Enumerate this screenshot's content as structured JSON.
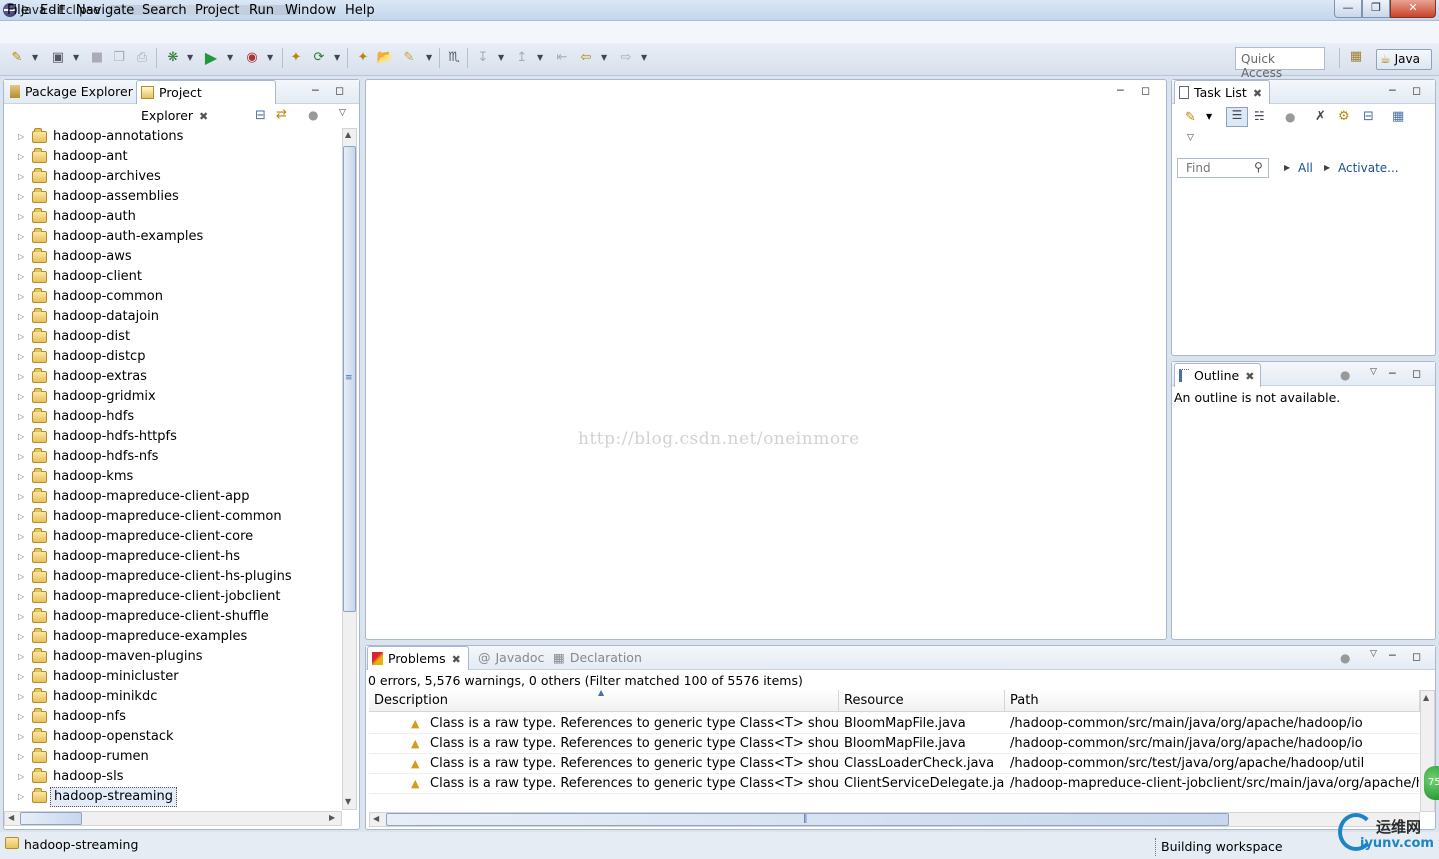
{
  "window": {
    "title": "Java - Eclipse"
  },
  "menu": [
    "File",
    "Edit",
    "Navigate",
    "Search",
    "Project",
    "Run",
    "Window",
    "Help"
  ],
  "toolbar": {
    "quick_access": "Quick Access",
    "perspective": "Java"
  },
  "left_panel": {
    "tabs": [
      "Package Explorer",
      "Project Explorer"
    ],
    "projects": [
      "hadoop-annotations",
      "hadoop-ant",
      "hadoop-archives",
      "hadoop-assemblies",
      "hadoop-auth",
      "hadoop-auth-examples",
      "hadoop-aws",
      "hadoop-client",
      "hadoop-common",
      "hadoop-datajoin",
      "hadoop-dist",
      "hadoop-distcp",
      "hadoop-extras",
      "hadoop-gridmix",
      "hadoop-hdfs",
      "hadoop-hdfs-httpfs",
      "hadoop-hdfs-nfs",
      "hadoop-kms",
      "hadoop-mapreduce-client-app",
      "hadoop-mapreduce-client-common",
      "hadoop-mapreduce-client-core",
      "hadoop-mapreduce-client-hs",
      "hadoop-mapreduce-client-hs-plugins",
      "hadoop-mapreduce-client-jobclient",
      "hadoop-mapreduce-client-shuffle",
      "hadoop-mapreduce-examples",
      "hadoop-maven-plugins",
      "hadoop-minicluster",
      "hadoop-minikdc",
      "hadoop-nfs",
      "hadoop-openstack",
      "hadoop-rumen",
      "hadoop-sls",
      "hadoop-streaming"
    ],
    "selected": "hadoop-streaming"
  },
  "editor": {
    "watermark": "http://blog.csdn.net/oneinmore"
  },
  "task_list": {
    "tab": "Task List",
    "find_placeholder": "Find",
    "all_label": "All",
    "activate_label": "Activate..."
  },
  "outline": {
    "tab": "Outline",
    "message": "An outline is not available."
  },
  "problems": {
    "tabs": [
      "Problems",
      "Javadoc",
      "Declaration"
    ],
    "summary": "0 errors, 5,576 warnings, 0 others (Filter matched 100 of 5576 items)",
    "columns": [
      "Description",
      "Resource",
      "Path"
    ],
    "rows": [
      {
        "description": "Class is a raw type. References to generic type Class<T> should be pa",
        "resource": "BloomMapFile.java",
        "path": "/hadoop-common/src/main/java/org/apache/hadoop/io"
      },
      {
        "description": "Class is a raw type. References to generic type Class<T> should be pa",
        "resource": "BloomMapFile.java",
        "path": "/hadoop-common/src/main/java/org/apache/hadoop/io"
      },
      {
        "description": "Class is a raw type. References to generic type Class<T> should be pa",
        "resource": "ClassLoaderCheck.java",
        "path": "/hadoop-common/src/test/java/org/apache/hadoop/util"
      },
      {
        "description": "Class is a raw type. References to generic type Class<T> should be pa",
        "resource": "ClientServiceDelegate.java",
        "path": "/hadoop-mapreduce-client-jobclient/src/main/java/org/apache/hadoo"
      }
    ]
  },
  "status": {
    "selection": "hadoop-streaming",
    "progress": "Building workspace"
  },
  "overlay": {
    "logo_text": "运维网",
    "logo_url": "iyunv.com",
    "badge": "75"
  }
}
